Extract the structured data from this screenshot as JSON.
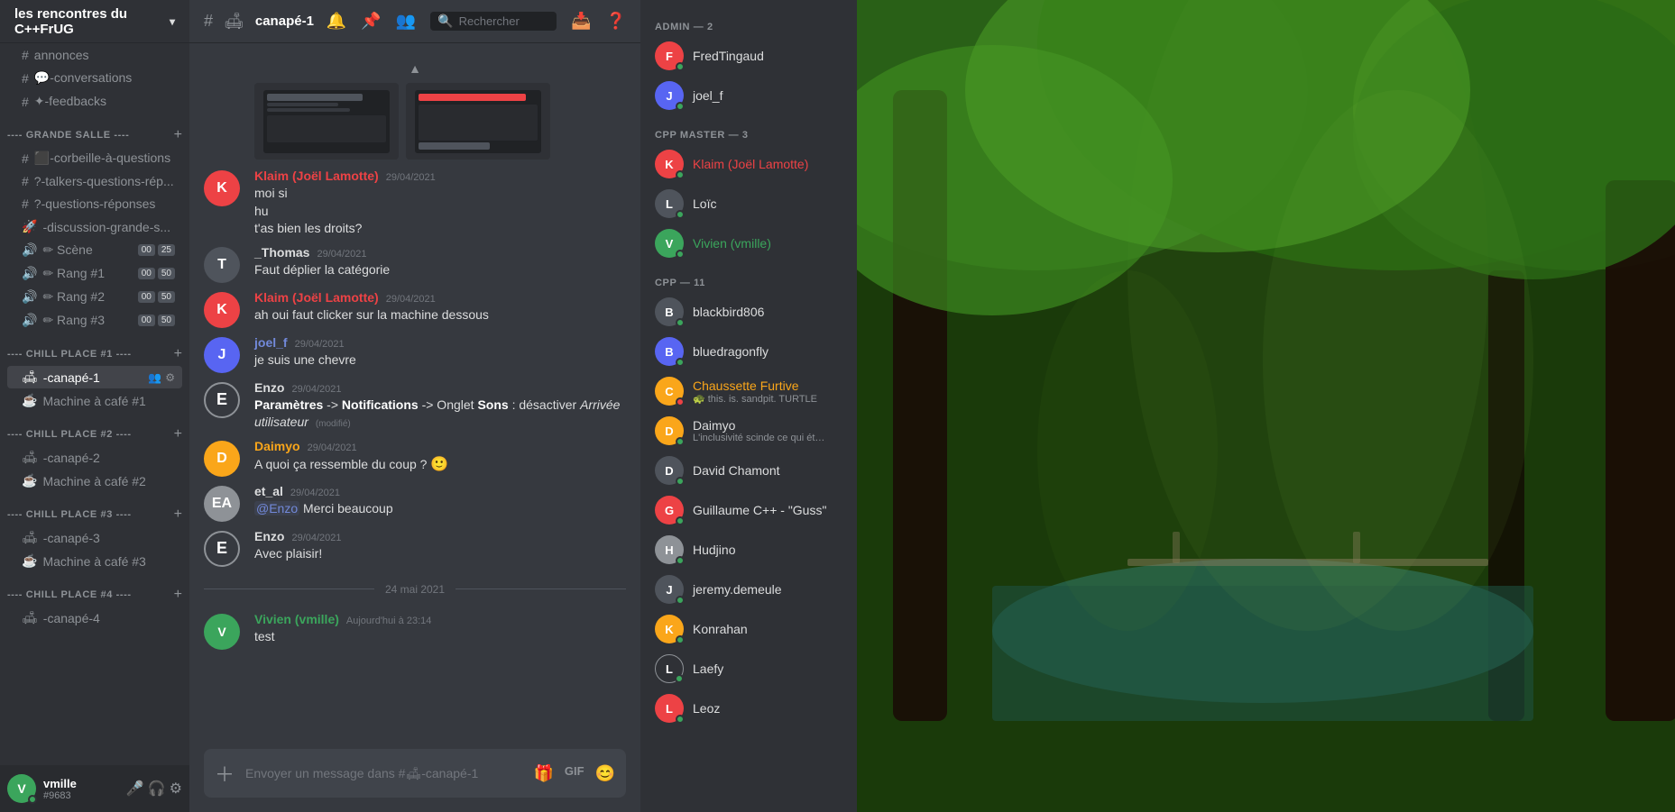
{
  "server": {
    "name": "les rencontres du C++FrUG",
    "channels": [
      {
        "id": "annonces",
        "type": "text",
        "icon": "#",
        "name": "annonces",
        "prefix": ""
      },
      {
        "id": "conversations",
        "type": "text",
        "icon": "💬",
        "name": "-conversations",
        "prefix": ""
      },
      {
        "id": "feedbacks",
        "type": "text",
        "icon": "✦",
        "name": "-feedbacks",
        "prefix": ""
      }
    ],
    "categories": [
      {
        "id": "grande-salle",
        "name": "---- GRANDE SALLE ----",
        "channels": [
          {
            "id": "corbeille",
            "type": "text",
            "icon": "#",
            "name": "⬛-corbeille-à-questions"
          },
          {
            "id": "talkers",
            "type": "text",
            "icon": "?",
            "name": "?-talkers-questions-rép..."
          },
          {
            "id": "questions",
            "type": "text",
            "icon": "?",
            "name": "?-questions-réponses"
          },
          {
            "id": "discussion",
            "type": "text",
            "icon": "🚀",
            "name": "🚀-discussion-grande-s..."
          },
          {
            "id": "scene",
            "type": "voice",
            "icon": "🔊",
            "name": "✏ Scène",
            "badges": [
              "00",
              "25"
            ]
          },
          {
            "id": "rang1",
            "type": "voice",
            "icon": "🔊",
            "name": "✏ Rang #1",
            "badges": [
              "00",
              "50"
            ]
          },
          {
            "id": "rang2",
            "type": "voice",
            "icon": "🔊",
            "name": "✏ Rang #2",
            "badges": [
              "00",
              "50"
            ]
          },
          {
            "id": "rang3",
            "type": "voice",
            "icon": "🔊",
            "name": "✏ Rang #3",
            "badges": [
              "00",
              "50"
            ]
          }
        ]
      },
      {
        "id": "chill1",
        "name": "---- CHILL PLACE #1 ----",
        "channels": [
          {
            "id": "canape1",
            "type": "text",
            "icon": "🛋",
            "name": "🛋-canapé-1",
            "active": true
          },
          {
            "id": "cafe1",
            "type": "voice",
            "icon": "☕",
            "name": "☕ Machine à café #1"
          }
        ]
      },
      {
        "id": "chill2",
        "name": "---- CHILL PLACE #2 ----",
        "channels": [
          {
            "id": "canape2",
            "type": "text",
            "icon": "🛋",
            "name": "🛋-canapé-2"
          },
          {
            "id": "cafe2",
            "type": "voice",
            "icon": "☕",
            "name": "☕ Machine à café #2"
          }
        ]
      },
      {
        "id": "chill3",
        "name": "---- CHILL PLACE #3 ----",
        "channels": [
          {
            "id": "canape3",
            "type": "text",
            "icon": "🛋",
            "name": "🛋-canapé-3"
          },
          {
            "id": "cafe3",
            "type": "voice",
            "icon": "☕",
            "name": "☕ Machine à café #3"
          }
        ]
      },
      {
        "id": "chill4",
        "name": "---- CHILL PLACE #4 ----",
        "channels": [
          {
            "id": "canape4",
            "type": "text",
            "icon": "🛋",
            "name": "🛋-canapé-4"
          }
        ]
      }
    ]
  },
  "user": {
    "name": "vmille",
    "tag": "#9683"
  },
  "channel": {
    "name": "🛋-canapé-1",
    "short": "canapé-1"
  },
  "search": {
    "placeholder": "Rechercher"
  },
  "messages": [
    {
      "id": "m1",
      "author": "Klaim (Joël Lamotte)",
      "author_color": "red",
      "time": "29/04/2021",
      "lines": [
        "moi si",
        "hu",
        "t'as bien les droits?"
      ],
      "has_image": true
    },
    {
      "id": "m2",
      "author": "_Thomas",
      "author_color": "grey",
      "time": "29/04/2021",
      "lines": [
        "Faut déplier la catégorie"
      ]
    },
    {
      "id": "m3",
      "author": "Klaim (Joël Lamotte)",
      "author_color": "red",
      "time": "29/04/2021",
      "lines": [
        "ah oui faut clicker sur la machine dessous"
      ]
    },
    {
      "id": "m4",
      "author": "joel_f",
      "author_color": "blue",
      "time": "29/04/2021",
      "lines": [
        "je suis une chevre"
      ]
    },
    {
      "id": "m5",
      "author": "Enzo",
      "author_color": "grey",
      "time": "29/04/2021",
      "lines": [
        "Paramètres -> Notifications -> Onglet Sons : désactiver Arrivée utilisateur"
      ],
      "modified": true
    },
    {
      "id": "m6",
      "author": "Daimyo",
      "author_color": "orange",
      "time": "29/04/2021",
      "lines": [
        "A quoi ça ressemble du coup ? 🙂"
      ]
    },
    {
      "id": "m7",
      "author": "et_al",
      "author_color": "grey",
      "time": "29/04/2021",
      "lines": [
        "@Enzo Merci beaucoup"
      ]
    },
    {
      "id": "m8",
      "author": "Enzo",
      "author_color": "grey",
      "time": "29/04/2021",
      "lines": [
        "Avec plaisir!"
      ]
    }
  ],
  "date_divider": "24 mai 2021",
  "last_message": {
    "author": "Vivien (vmille)",
    "author_color": "green",
    "time": "Aujourd'hui à 23:14",
    "lines": [
      "test"
    ]
  },
  "input": {
    "placeholder": "Envoyer un message dans #🛋-canapé-1"
  },
  "members": {
    "admin": {
      "title": "ADMIN — 2",
      "list": [
        {
          "name": "FredTingaud",
          "color": "default",
          "bg": "#ed4245"
        },
        {
          "name": "joel_f",
          "color": "default",
          "bg": "#5865f2"
        }
      ]
    },
    "cpp_master": {
      "title": "CPP MASTER — 3",
      "list": [
        {
          "name": "Klaim (Joël Lamotte)",
          "color": "red",
          "bg": "#ed4245"
        },
        {
          "name": "Loïc",
          "color": "default",
          "bg": "#4f545c"
        },
        {
          "name": "Vivien (vmille)",
          "color": "green",
          "bg": "#3ba55c"
        }
      ]
    },
    "cpp": {
      "title": "CPP — 11",
      "list": [
        {
          "name": "blackbird806",
          "color": "default",
          "bg": "#4f545c",
          "sub": ""
        },
        {
          "name": "bluedragonfly",
          "color": "default",
          "bg": "#5865f2",
          "sub": ""
        },
        {
          "name": "Chaussette Furtive",
          "color": "orange",
          "bg": "#faa61a",
          "sub": "🐢 this. is. sandpit. TURTLE"
        },
        {
          "name": "Daimyo",
          "color": "default",
          "bg": "#faa61a",
          "sub": "L'inclusivité scinde ce qui était ..."
        },
        {
          "name": "David Chamont",
          "color": "default",
          "bg": "#4f545c",
          "sub": ""
        },
        {
          "name": "Guillaume C++ - \"Guss\"",
          "color": "default",
          "bg": "#ed4245",
          "sub": ""
        },
        {
          "name": "Hudjino",
          "color": "default",
          "bg": "#8e9297",
          "sub": ""
        },
        {
          "name": "jeremy.demeule",
          "color": "default",
          "bg": "#4f545c",
          "sub": ""
        },
        {
          "name": "Konrahan",
          "color": "default",
          "bg": "#faa61a",
          "sub": ""
        },
        {
          "name": "Laefy",
          "color": "default",
          "bg": "#2f3136",
          "sub": ""
        },
        {
          "name": "Leoz",
          "color": "default",
          "bg": "#ed4245",
          "sub": ""
        }
      ]
    }
  }
}
